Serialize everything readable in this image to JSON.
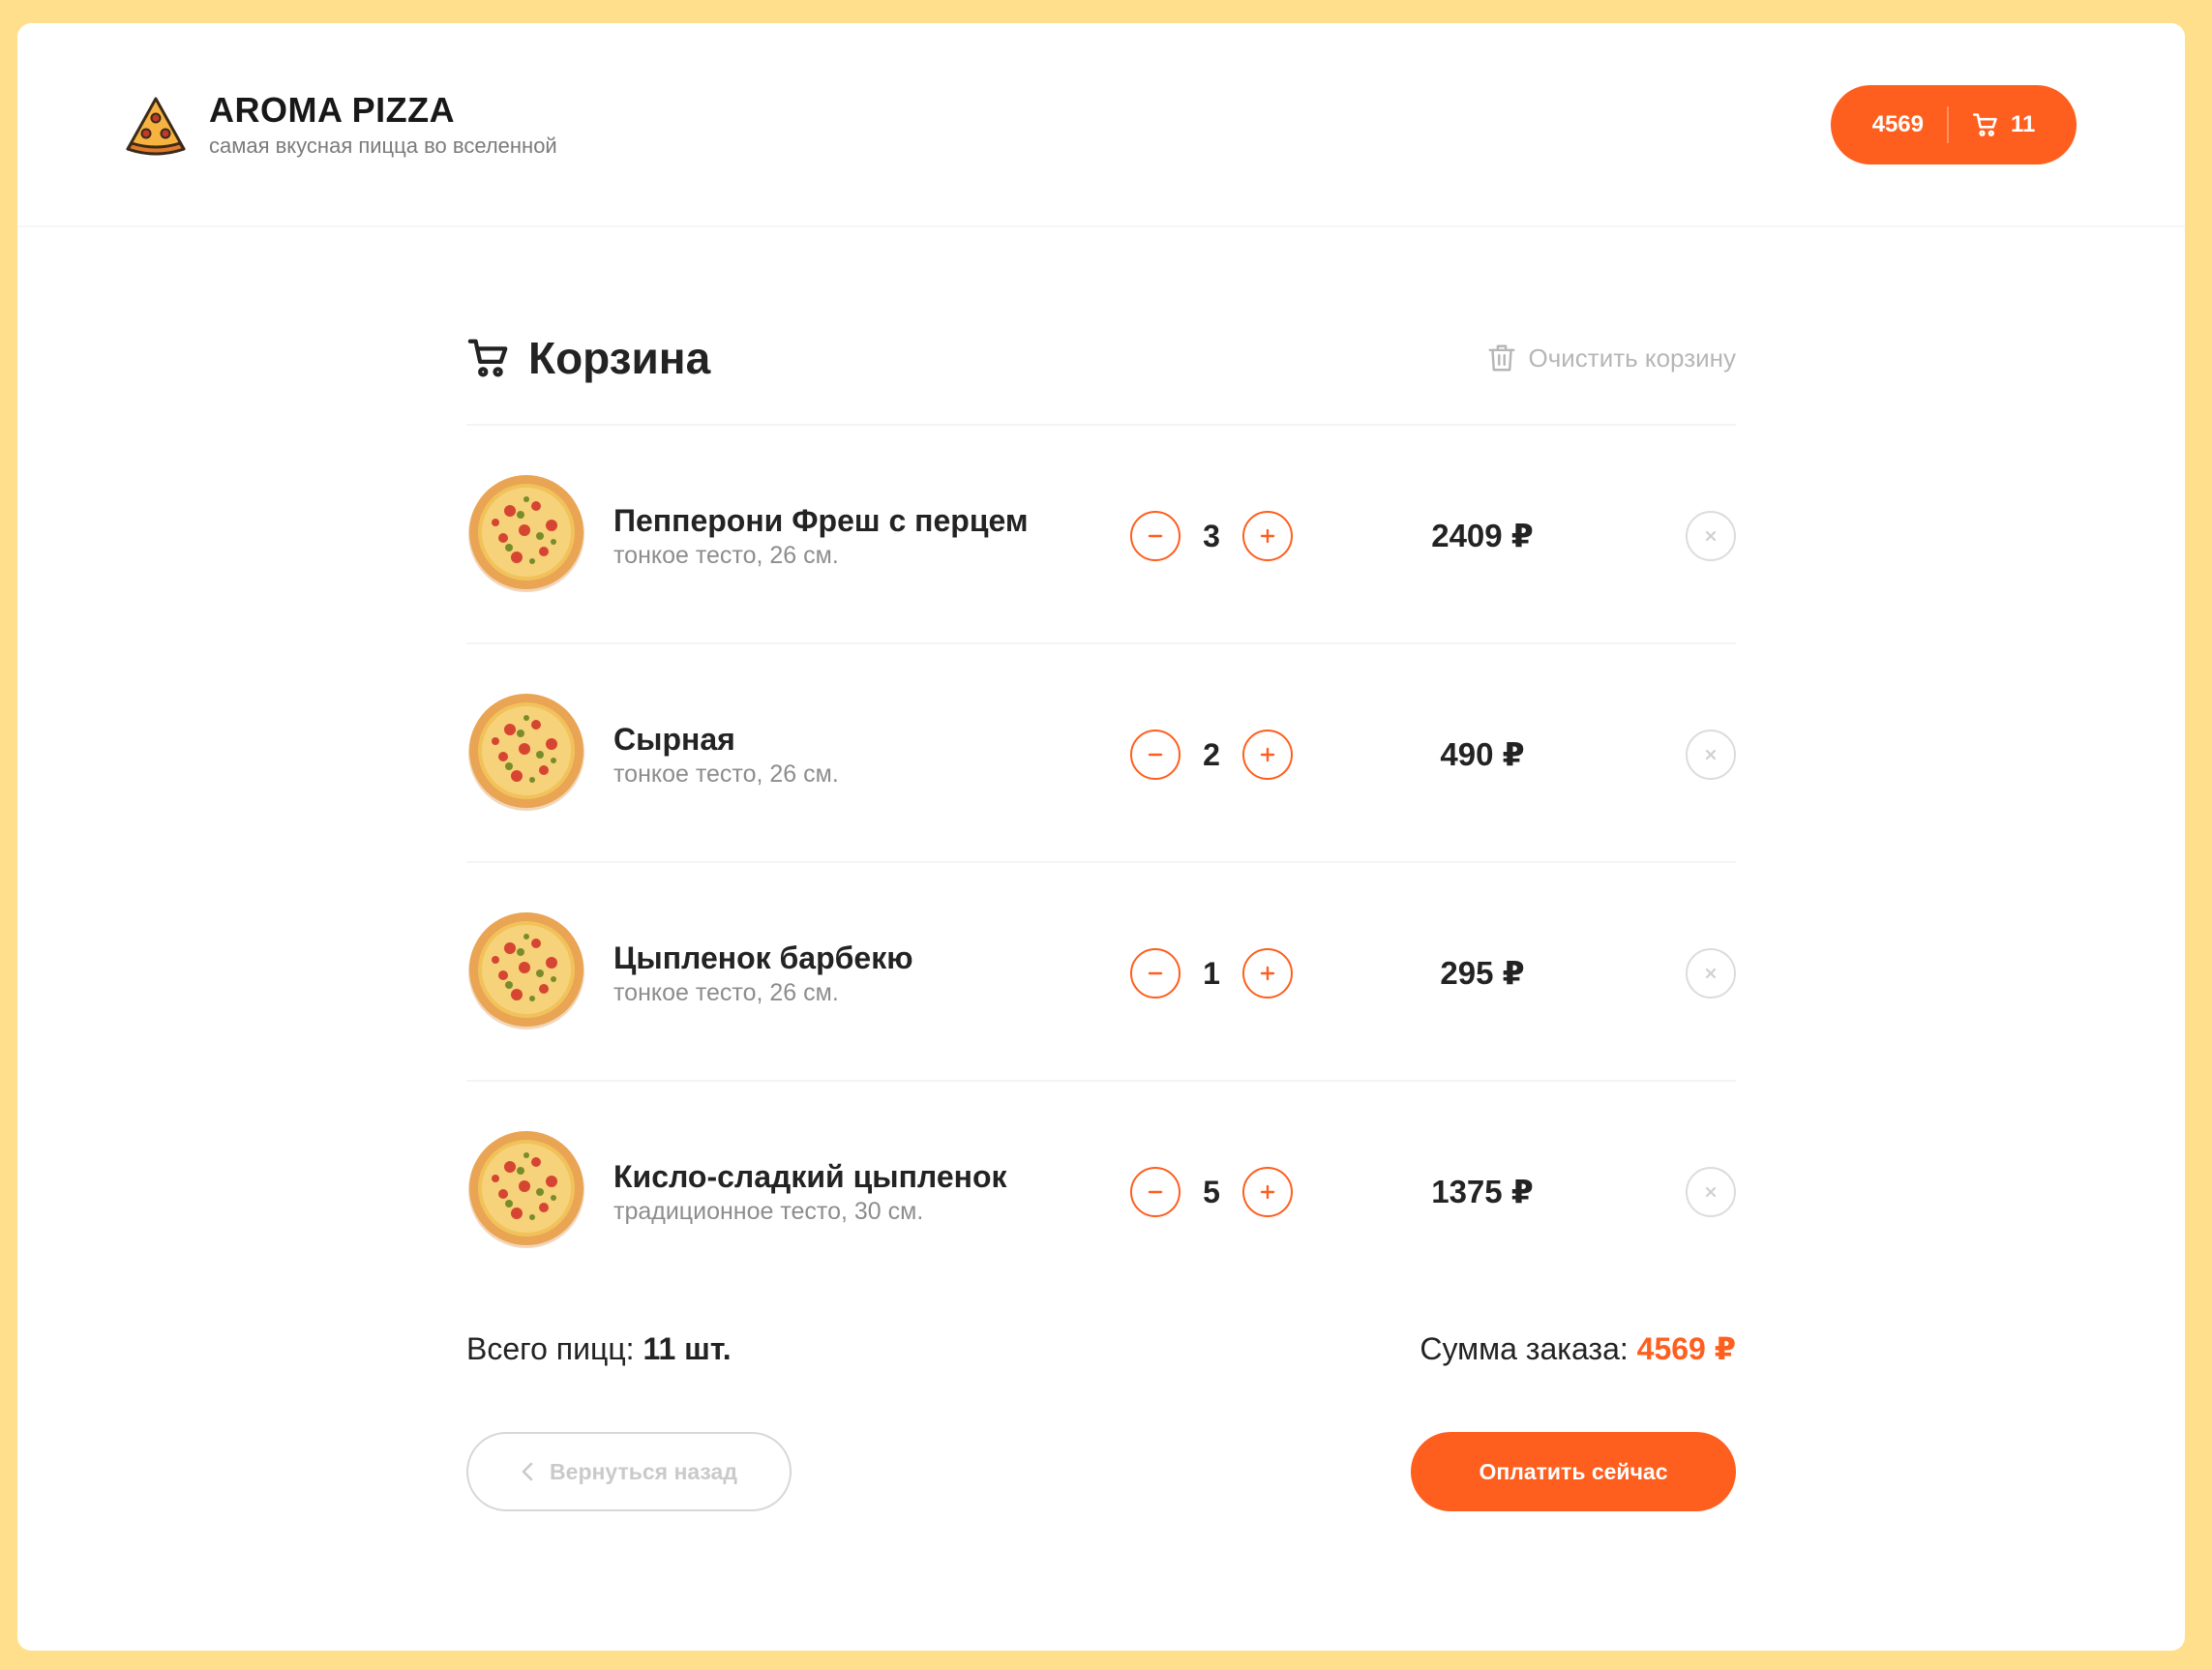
{
  "brand": {
    "title": "AROMA PIZZA",
    "subtitle": "самая вкусная пицца во вселенной",
    "logo_icon": "pizza-slice-icon"
  },
  "header_cart": {
    "sum": "4569",
    "count": "11",
    "icon": "cart-icon"
  },
  "cart": {
    "title": "Корзина",
    "clear_label": "Очистить корзину",
    "items": [
      {
        "name": "Пепперони Фреш с перцем",
        "desc": "тонкое тесто, 26 см.",
        "qty": "3",
        "price": "2409 ₽"
      },
      {
        "name": "Сырная",
        "desc": "тонкое тесто, 26 см.",
        "qty": "2",
        "price": "490 ₽"
      },
      {
        "name": "Цыпленок барбекю",
        "desc": "тонкое тесто, 26 см.",
        "qty": "1",
        "price": "295 ₽"
      },
      {
        "name": "Кисло-сладкий цыпленок",
        "desc": "традиционное тесто, 30 см.",
        "qty": "5",
        "price": "1375 ₽"
      }
    ],
    "total_count_label": "Всего пицц:",
    "total_count_value": "11 шт.",
    "total_sum_label": "Сумма заказа:",
    "total_sum_value": "4569 ₽",
    "back_label": "Вернуться назад",
    "pay_label": "Оплатить сейчас"
  },
  "colors": {
    "accent": "#fe5f1e",
    "background": "#ffdf8c"
  }
}
